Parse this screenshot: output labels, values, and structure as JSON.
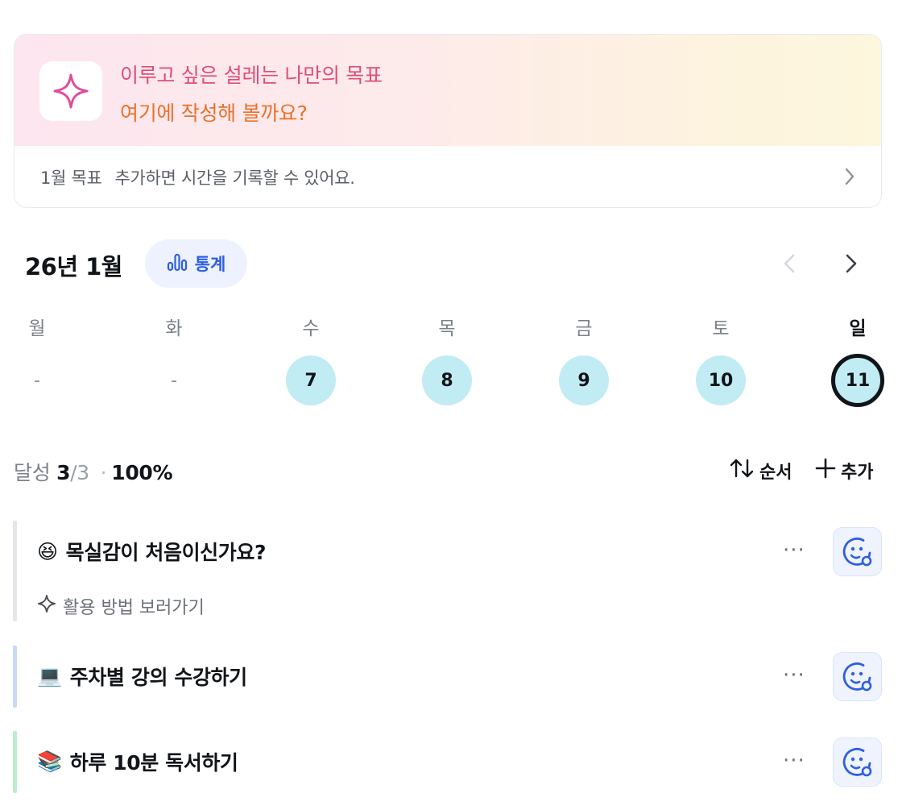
{
  "goal_banner": {
    "line1": "이루고 싶은 설레는 나만의 목표",
    "line2": "여기에 작성해 볼까요?",
    "month_goal": "1월 목표",
    "hint": "추가하면 시간을 기록할 수 있어요.",
    "colors": {
      "line1": "#de4e79",
      "line2": "#e8722b"
    }
  },
  "calendar": {
    "month_title": "26년 1월",
    "stats_label": "통계",
    "weekdays": [
      "월",
      "화",
      "수",
      "목",
      "금",
      "토",
      "일"
    ],
    "days": [
      "-",
      "-",
      "7",
      "8",
      "9",
      "10",
      "11"
    ],
    "today_index": 6,
    "done_color": "#c2ecf3"
  },
  "summary": {
    "label": "달성",
    "done": "3",
    "total": "/3",
    "separator": "·",
    "percent": "100%",
    "order_label": "순서",
    "add_label": "추가"
  },
  "tasks": [
    {
      "emoji": "😆",
      "title": "목실감이 처음이신가요?",
      "sub": "활용 방법 보러가기",
      "bar_color": "#e4e6ea",
      "more": "···"
    },
    {
      "emoji": "💻",
      "title": "주차별 강의 수강하기",
      "bar_color": "#c9d7f8",
      "more": "···"
    },
    {
      "emoji": "📚",
      "title": "하루 10분 독서하기",
      "bar_color": "#bdeccf",
      "more": "···"
    }
  ]
}
